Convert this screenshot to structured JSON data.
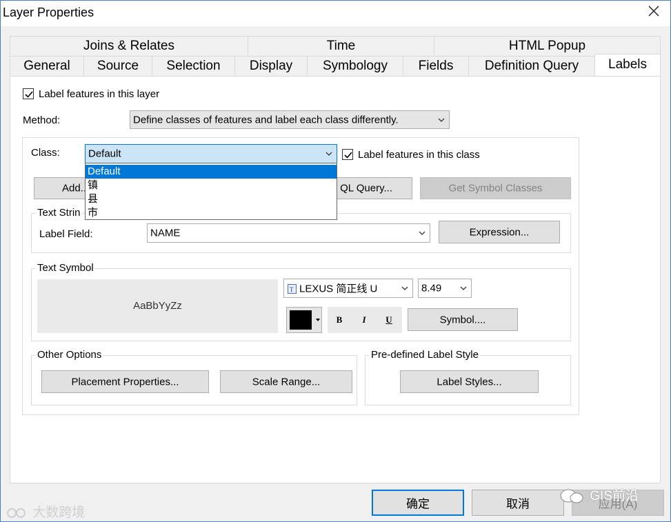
{
  "window": {
    "title": "Layer Properties"
  },
  "tabs": {
    "row1": [
      "Joins & Relates",
      "Time",
      "HTML Popup"
    ],
    "row2": [
      "General",
      "Source",
      "Selection",
      "Display",
      "Symbology",
      "Fields",
      "Definition Query",
      "Labels"
    ],
    "active": "Labels"
  },
  "labels_tab": {
    "label_features_in_layer": {
      "label": "Label features in this layer",
      "checked": true
    },
    "method": {
      "label": "Method:",
      "value": "Define classes of features and label each class differently."
    },
    "class": {
      "label": "Class:",
      "value": "Default",
      "options": [
        "Default",
        "镇",
        "县",
        "市"
      ],
      "selected": "Default"
    },
    "label_features_in_class": {
      "label": "Label features in this class",
      "checked": true
    },
    "buttons": {
      "add": "Add...",
      "sql_query": "SQL Query...",
      "sql_query_visible": "QL Query...",
      "get_symbol_classes": "Get Symbol Classes"
    },
    "text_string": {
      "title": "Text String",
      "title_visible": "Text Strin",
      "label_field_label": "Label Field:",
      "label_field_value": "NAME",
      "expression_button": "Expression..."
    },
    "text_symbol": {
      "title": "Text Symbol",
      "preview_text": "AaBbYyZz",
      "font_value": "LEXUS 简正线 U",
      "size_value": "8.49",
      "color": "#000000",
      "bold": "B",
      "italic": "I",
      "underline": "U",
      "symbol_button": "Symbol...."
    },
    "other_options": {
      "title": "Other Options",
      "placement_button": "Placement Properties...",
      "scale_range_button": "Scale Range..."
    },
    "predefined_style": {
      "title": "Pre-defined Label Style",
      "label_styles_button": "Label Styles..."
    }
  },
  "footer": {
    "ok": "确定",
    "cancel": "取消",
    "apply": "应用(A)"
  },
  "watermarks": {
    "left": "大数跨境",
    "right": "GIS前沿"
  },
  "colors": {
    "accent": "#0078d7",
    "dialog_bg": "#f0f0f0",
    "selection_bg": "#cce4f7"
  }
}
